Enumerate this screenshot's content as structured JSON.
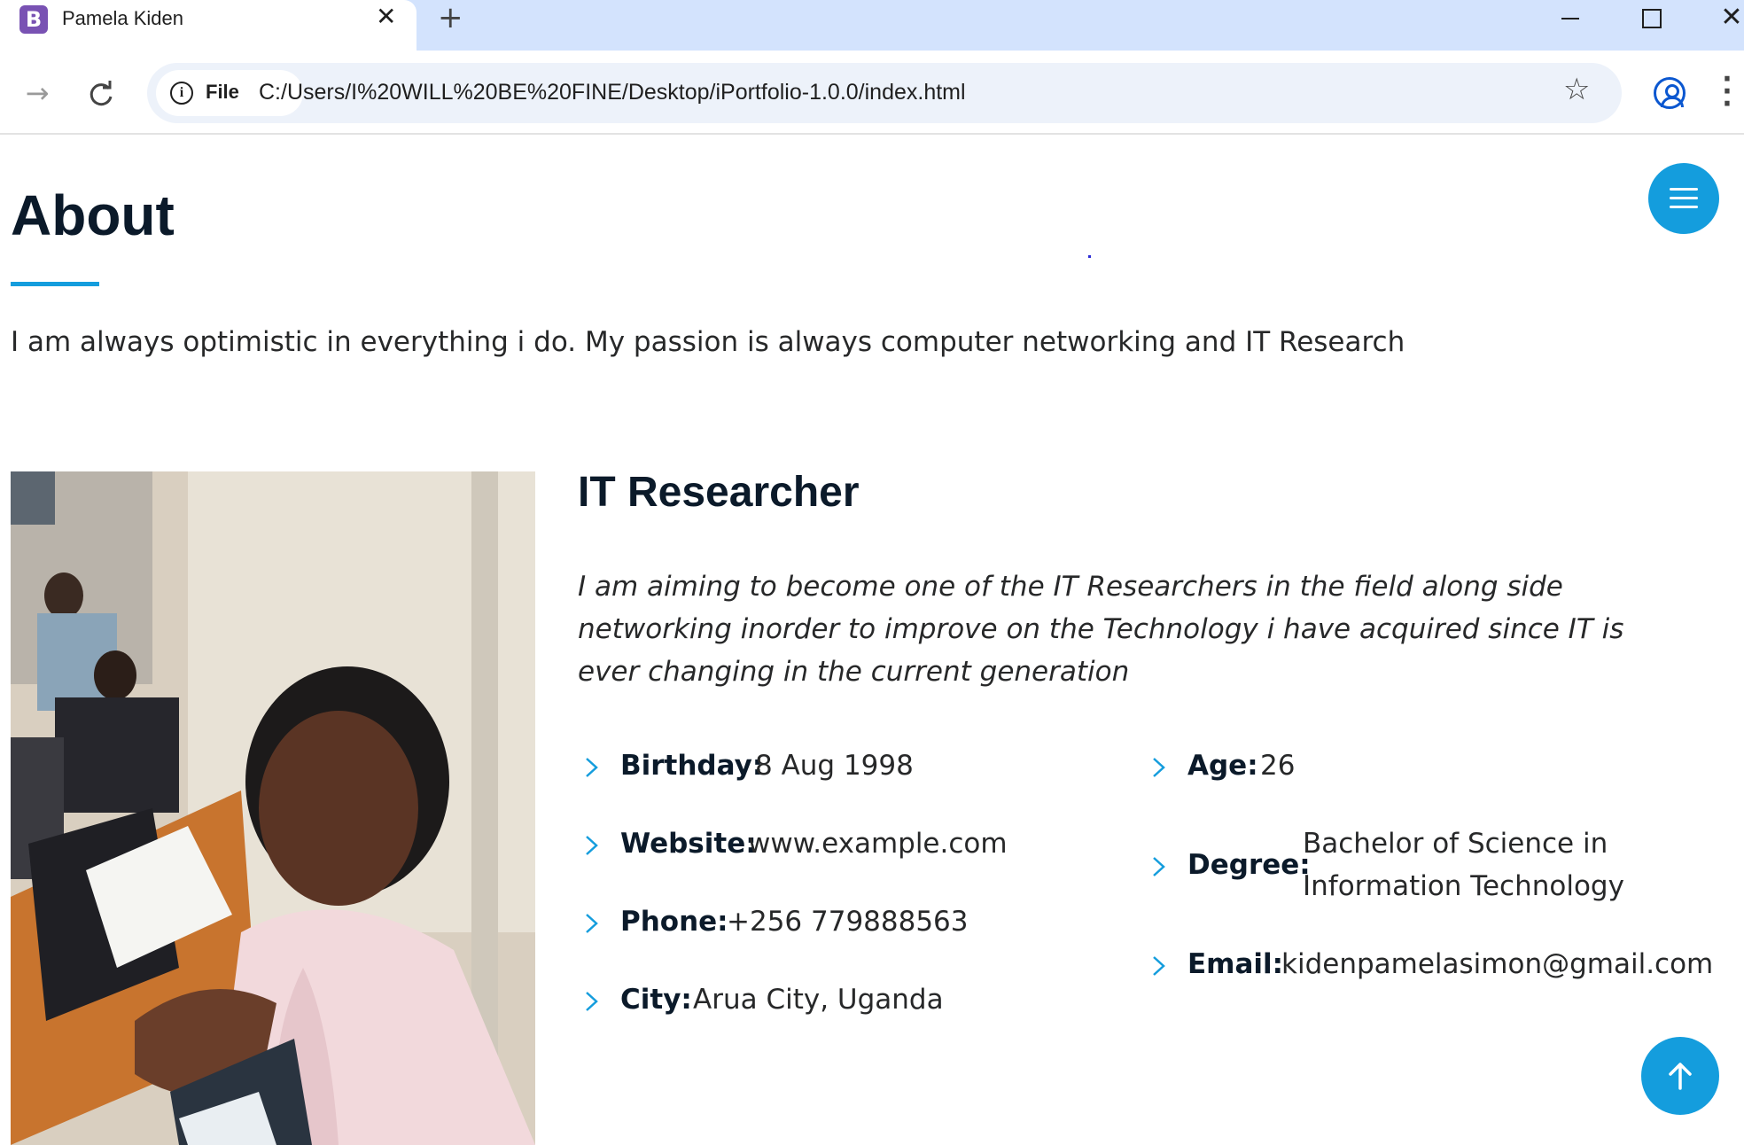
{
  "browser": {
    "tab_title": "Pamela Kiden",
    "favicon_letter": "B",
    "site_chip_label": "File",
    "url": "C:/Users/I%20WILL%20BE%20FINE/Desktop/iPortfolio-1.0.0/index.html",
    "icons": [
      "close-icon",
      "plus-icon",
      "minimize-icon",
      "maximize-icon",
      "window-close-icon",
      "forward-icon",
      "reload-icon",
      "info-icon",
      "star-icon",
      "profile-icon",
      "menu-icon"
    ]
  },
  "about": {
    "title": "About",
    "intro": "I am always optimistic in everything i do. My passion is always computer networking and IT Research",
    "role_title": "IT Researcher",
    "role_description": "I am aiming to become one of the IT Researchers in the field along side networking inorder to improve on the Technology i have acquired since IT is ever changing in the current generation",
    "details_left": [
      {
        "label": "Birthday:",
        "value": "8 Aug 1998"
      },
      {
        "label": "Website:",
        "value": "www.example.com"
      },
      {
        "label": "Phone:",
        "value": "+256 779888563"
      },
      {
        "label": "City:",
        "value": "Arua City, Uganda"
      }
    ],
    "details_right": [
      {
        "label": "Age:",
        "value": "26"
      },
      {
        "label": "Degree:",
        "value_line1": "Bachelor of Science in",
        "value_line2": "Information Technology"
      },
      {
        "label": "Email:",
        "value": "kidenpamelasimon@gmail.com"
      }
    ]
  },
  "colors": {
    "accent": "#149ddd",
    "heading": "#0b1a2a",
    "text": "#272829"
  }
}
